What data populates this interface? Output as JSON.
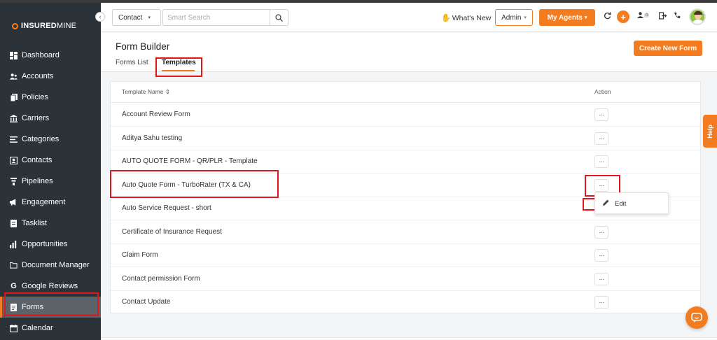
{
  "app": {
    "brand_bold": "INSURED",
    "brand_rest": "MINE"
  },
  "sidebar": {
    "collapse_glyph": "‹",
    "items": [
      {
        "label": "Dashboard",
        "icon": "dashboard-icon"
      },
      {
        "label": "Accounts",
        "icon": "accounts-icon"
      },
      {
        "label": "Policies",
        "icon": "policies-icon"
      },
      {
        "label": "Carriers",
        "icon": "carriers-icon"
      },
      {
        "label": "Categories",
        "icon": "categories-icon"
      },
      {
        "label": "Contacts",
        "icon": "contacts-icon"
      },
      {
        "label": "Pipelines",
        "icon": "pipelines-icon"
      },
      {
        "label": "Engagement",
        "icon": "engagement-icon"
      },
      {
        "label": "Tasklist",
        "icon": "tasklist-icon"
      },
      {
        "label": "Opportunities",
        "icon": "opportunities-icon"
      },
      {
        "label": "Document Manager",
        "icon": "folder-icon"
      },
      {
        "label": "Google Reviews",
        "icon": "google-icon"
      },
      {
        "label": "Forms",
        "icon": "forms-icon",
        "active": true
      },
      {
        "label": "Calendar",
        "icon": "calendar-icon"
      }
    ]
  },
  "header": {
    "contact_select": "Contact",
    "search_placeholder": "Smart Search",
    "whats_new": "What's New",
    "admin": "Admin",
    "my_agents": "My Agents",
    "notif_count": "0"
  },
  "page": {
    "title": "Form Builder",
    "tabs": [
      {
        "label": "Forms List"
      },
      {
        "label": "Templates",
        "active": true
      }
    ],
    "create_button": "Create New Form"
  },
  "table": {
    "col_name": "Template Name ⇕",
    "col_action": "Action",
    "action_glyph": "···",
    "rows": [
      "Account Review Form",
      "Aditya Sahu testing",
      "AUTO QUOTE FORM - QR/PLR - Template",
      "Auto Quote Form - TurboRater (TX & CA)",
      "Auto Service Request - short",
      "Certificate of Insurance Request",
      "Claim Form",
      "Contact permission Form",
      "Contact Update"
    ]
  },
  "context_menu": {
    "edit": "Edit"
  },
  "help_tab": "Help",
  "colors": {
    "accent": "#f47c20",
    "sidebar": "#2b3238",
    "highlight": "#e4141b"
  }
}
